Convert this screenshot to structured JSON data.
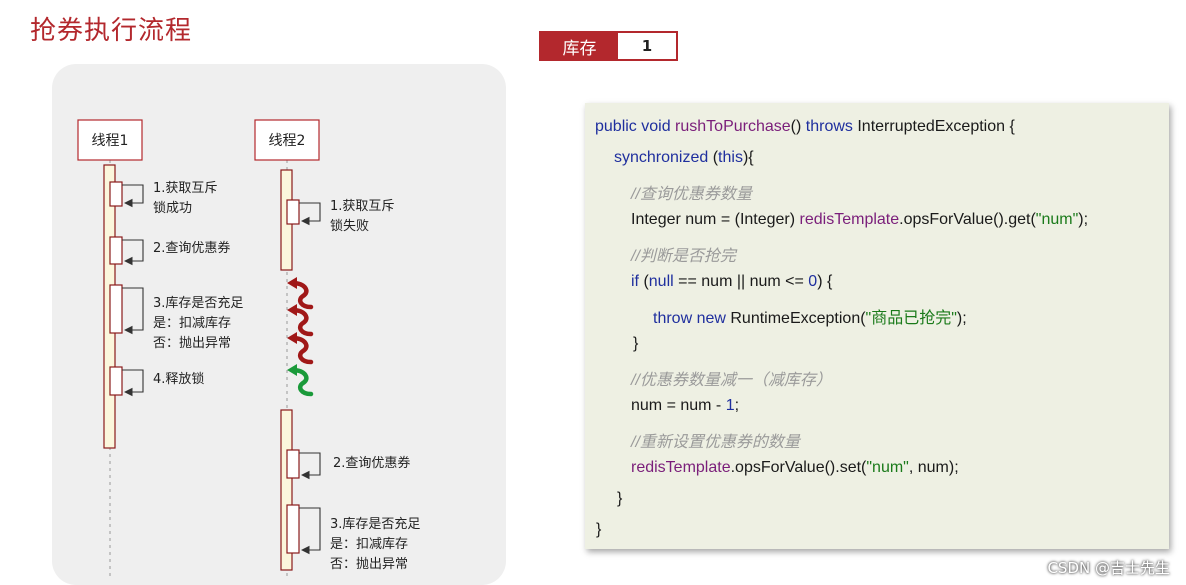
{
  "title": "抢券执行流程",
  "stock": {
    "label": "库存",
    "value": "1"
  },
  "threads": {
    "t1": {
      "label": "线程1",
      "steps": [
        [
          "1.获取互斥",
          "锁成功"
        ],
        [
          "2.查询优惠券"
        ],
        [
          "3.库存是否充足",
          "是：扣减库存",
          "否：抛出异常"
        ],
        [
          "4.释放锁"
        ]
      ]
    },
    "t2": {
      "label": "线程2",
      "steps": [
        [
          "1.获取互斥",
          "锁失败"
        ],
        [
          "2.查询优惠券"
        ],
        [
          "3.库存是否充足",
          "是：扣减库存",
          "否：抛出异常"
        ]
      ]
    }
  },
  "retry_colors": {
    "fail": "#a01818",
    "success": "#1a9a3a"
  },
  "code": [
    [
      {
        "t": "public void ",
        "c": "kw"
      },
      {
        "t": "rushToPurchase",
        "c": "fn"
      },
      {
        "t": "() ",
        "c": ""
      },
      {
        "t": "throws ",
        "c": "kw"
      },
      {
        "t": "InterruptedException {",
        "c": ""
      }
    ],
    [
      {
        "t": "synchronized ",
        "c": "kw"
      },
      {
        "t": "(",
        "c": ""
      },
      {
        "t": "this",
        "c": "kw"
      },
      {
        "t": "){",
        "c": ""
      }
    ],
    [
      {
        "t": "//查询优惠券数量",
        "c": "cmt"
      }
    ],
    [
      {
        "t": "Integer num = (Integer) ",
        "c": ""
      },
      {
        "t": "redisTemplate",
        "c": "fn"
      },
      {
        "t": ".opsForValue().get(",
        "c": ""
      },
      {
        "t": "\"num\"",
        "c": "str"
      },
      {
        "t": ");",
        "c": ""
      }
    ],
    [
      {
        "t": "//判断是否抢完",
        "c": "cmt"
      }
    ],
    [
      {
        "t": "if ",
        "c": "kw"
      },
      {
        "t": "(",
        "c": ""
      },
      {
        "t": "null",
        "c": "kw"
      },
      {
        "t": " == num || num <= ",
        "c": ""
      },
      {
        "t": "0",
        "c": "num"
      },
      {
        "t": ") {",
        "c": ""
      }
    ],
    [
      {
        "t": "throw new ",
        "c": "kw"
      },
      {
        "t": "RuntimeException(",
        "c": ""
      },
      {
        "t": "\"商品已抢完\"",
        "c": "str"
      },
      {
        "t": ");",
        "c": ""
      }
    ],
    [
      {
        "t": "}",
        "c": ""
      }
    ],
    [
      {
        "t": "//优惠券数量减一（减库存）",
        "c": "cmt"
      }
    ],
    [
      {
        "t": "num = num - ",
        "c": ""
      },
      {
        "t": "1",
        "c": "num"
      },
      {
        "t": ";",
        "c": ""
      }
    ],
    [
      {
        "t": "//重新设置优惠券的数量",
        "c": "cmt"
      }
    ],
    [
      {
        "t": "redisTemplate",
        "c": "fn"
      },
      {
        "t": ".opsForValue().set(",
        "c": ""
      },
      {
        "t": "\"num\"",
        "c": "str"
      },
      {
        "t": ", num);",
        "c": ""
      }
    ],
    [
      {
        "t": "}",
        "c": ""
      }
    ],
    [
      {
        "t": "}",
        "c": ""
      }
    ]
  ],
  "watermark": "CSDN @吉士先生"
}
